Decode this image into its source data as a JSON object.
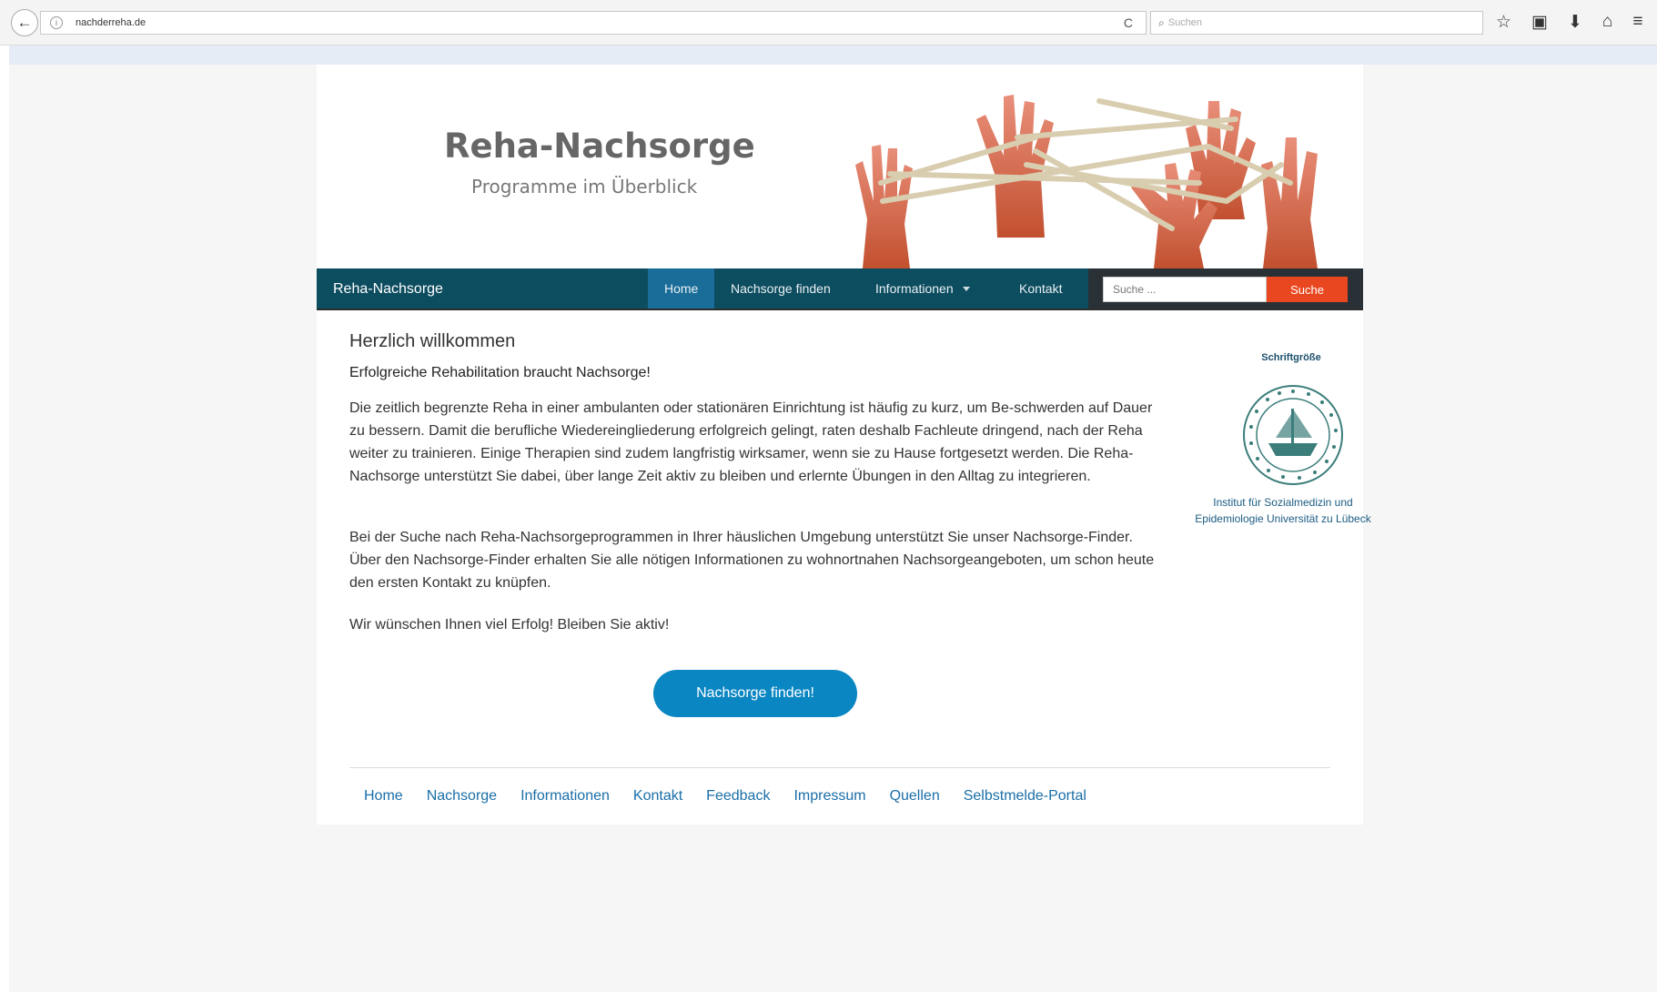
{
  "browser": {
    "url": "nachderreha.de",
    "search_placeholder": "Suchen",
    "back_icon": "←",
    "info_icon": "i",
    "reload_icon": "C",
    "search_icon": "⌕",
    "toolbar_icons": [
      "☆",
      "▣",
      "⬇",
      "⌂",
      "≡"
    ]
  },
  "header": {
    "title": "Reha-Nachsorge",
    "subtitle": "Programme im Überblick"
  },
  "navbar": {
    "brand": "Reha-Nachsorge",
    "items": [
      {
        "label": "Home",
        "active": true
      },
      {
        "label": "Nachsorge finden"
      },
      {
        "label": "Informationen"
      },
      {
        "label": "Kontakt"
      }
    ],
    "search_placeholder": "Suche ...",
    "search_button": "Suche"
  },
  "main": {
    "heading": "Herzlich willkommen",
    "lead": "Erfolgreiche Rehabilitation braucht Nachsorge!",
    "paragraphs": [
      "Die zeitlich begrenzte Reha in einer ambulanten oder stationären Einrichtung ist häufig zu kurz, um Be-schwerden auf Dauer zu bessern. Damit die berufliche Wiedereingliederung erfolgreich gelingt, raten deshalb Fachleute dringend, nach der Reha weiter zu trainieren. Einige Therapien sind zudem langfristig wirksamer, wenn sie zu Hause fortgesetzt werden. Die Reha-Nachsorge unterstützt Sie dabei, über lange Zeit aktiv zu bleiben und erlernte Übungen in den Alltag zu integrieren.",
      "Bei der Suche nach Reha-Nachsorgeprogrammen in Ihrer häuslichen Umgebung unterstützt Sie unser Nachsorge-Finder. Über den Nachsorge-Finder erhalten Sie alle nötigen Informationen zu wohnortnahen Nachsorgeangeboten, um schon heute den ersten Kontakt zu knüpfen.",
      "Wir wünschen Ihnen viel Erfolg! Bleiben Sie aktiv!"
    ],
    "cta": "Nachsorge finden!"
  },
  "sidebar": {
    "font_size_label": "Schriftgröße",
    "institute": "Institut für Sozialmedizin und Epidemiologie Universität zu Lübeck"
  },
  "footer": {
    "links": [
      "Home",
      "Nachsorge",
      "Informationen",
      "Kontakt",
      "Feedback",
      "Impressum",
      "Quellen",
      "Selbstmelde-Portal"
    ]
  },
  "colors": {
    "nav": "#0d4d60",
    "nav_active": "#1a6d99",
    "search_button": "#e94720",
    "cta": "#0a86c2",
    "link": "#1a6ea8"
  }
}
